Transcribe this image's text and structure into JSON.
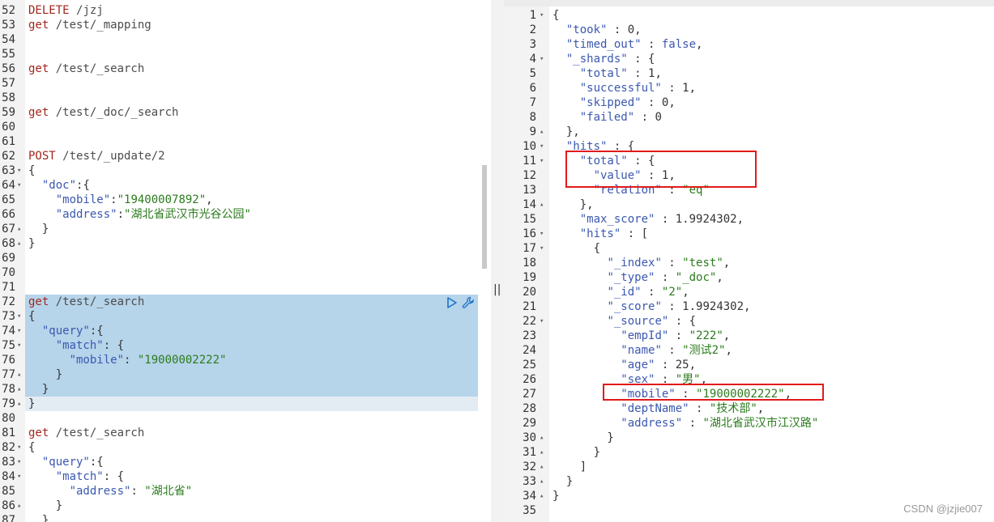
{
  "request_editor": {
    "lines": [
      {
        "n": "52",
        "fold": "",
        "html": [
          [
            "kw-method",
            "DELETE "
          ],
          [
            "kw-path",
            "/jzj"
          ]
        ]
      },
      {
        "n": "53",
        "fold": "",
        "html": [
          [
            "kw-method",
            "get "
          ],
          [
            "kw-path",
            "/test/_mapping"
          ]
        ]
      },
      {
        "n": "54",
        "fold": "",
        "html": []
      },
      {
        "n": "55",
        "fold": "",
        "html": []
      },
      {
        "n": "56",
        "fold": "",
        "html": [
          [
            "kw-method",
            "get "
          ],
          [
            "kw-path",
            "/test/_search"
          ]
        ]
      },
      {
        "n": "57",
        "fold": "",
        "html": []
      },
      {
        "n": "58",
        "fold": "",
        "html": []
      },
      {
        "n": "59",
        "fold": "",
        "html": [
          [
            "kw-method",
            "get "
          ],
          [
            "kw-path",
            "/test/_doc/_search"
          ]
        ]
      },
      {
        "n": "60",
        "fold": "",
        "html": []
      },
      {
        "n": "61",
        "fold": "",
        "html": []
      },
      {
        "n": "62",
        "fold": "",
        "html": [
          [
            "kw-method",
            "POST "
          ],
          [
            "kw-path",
            "/test/_update/2"
          ]
        ]
      },
      {
        "n": "63",
        "fold": "▾",
        "html": [
          [
            "punc",
            "{"
          ]
        ]
      },
      {
        "n": "64",
        "fold": "▾",
        "html": [
          [
            "punc",
            "  "
          ],
          [
            "k",
            "\"doc\""
          ],
          [
            "punc",
            ":{"
          ]
        ]
      },
      {
        "n": "65",
        "fold": "",
        "html": [
          [
            "punc",
            "    "
          ],
          [
            "k",
            "\"mobile\""
          ],
          [
            "punc",
            ":"
          ],
          [
            "s",
            "\"19400007892\""
          ],
          [
            "punc",
            ","
          ]
        ]
      },
      {
        "n": "66",
        "fold": "",
        "html": [
          [
            "punc",
            "    "
          ],
          [
            "k",
            "\"address\""
          ],
          [
            "punc",
            ":"
          ],
          [
            "s",
            "\"湖北省武汉市光谷公园\""
          ]
        ]
      },
      {
        "n": "67",
        "fold": "▴",
        "html": [
          [
            "punc",
            "  }"
          ]
        ]
      },
      {
        "n": "68",
        "fold": "▴",
        "html": [
          [
            "punc",
            "}"
          ]
        ]
      },
      {
        "n": "69",
        "fold": "",
        "html": []
      },
      {
        "n": "70",
        "fold": "",
        "html": []
      },
      {
        "n": "71",
        "fold": "",
        "html": []
      },
      {
        "n": "72",
        "fold": "",
        "html": [
          [
            "kw-method",
            "get "
          ],
          [
            "kw-path",
            "/test/_search"
          ]
        ]
      },
      {
        "n": "73",
        "fold": "▾",
        "html": [
          [
            "punc",
            "{"
          ]
        ]
      },
      {
        "n": "74",
        "fold": "▾",
        "html": [
          [
            "punc",
            "  "
          ],
          [
            "k",
            "\"query\""
          ],
          [
            "punc",
            ":{"
          ]
        ]
      },
      {
        "n": "75",
        "fold": "▾",
        "html": [
          [
            "punc",
            "    "
          ],
          [
            "k",
            "\"match\""
          ],
          [
            "punc",
            ": {"
          ]
        ]
      },
      {
        "n": "76",
        "fold": "",
        "html": [
          [
            "punc",
            "      "
          ],
          [
            "k",
            "\"mobile\""
          ],
          [
            "punc",
            ": "
          ],
          [
            "s",
            "\"19000002222\""
          ]
        ]
      },
      {
        "n": "77",
        "fold": "▴",
        "html": [
          [
            "punc",
            "    }"
          ]
        ]
      },
      {
        "n": "78",
        "fold": "▴",
        "html": [
          [
            "punc",
            "  }"
          ]
        ]
      },
      {
        "n": "79",
        "fold": "▴",
        "html": [
          [
            "punc",
            "}"
          ]
        ]
      },
      {
        "n": "80",
        "fold": "",
        "html": []
      },
      {
        "n": "81",
        "fold": "",
        "html": [
          [
            "kw-method",
            "get "
          ],
          [
            "kw-path",
            "/test/_search"
          ]
        ]
      },
      {
        "n": "82",
        "fold": "▾",
        "html": [
          [
            "punc",
            "{"
          ]
        ]
      },
      {
        "n": "83",
        "fold": "▾",
        "html": [
          [
            "punc",
            "  "
          ],
          [
            "k",
            "\"query\""
          ],
          [
            "punc",
            ":{"
          ]
        ]
      },
      {
        "n": "84",
        "fold": "▾",
        "html": [
          [
            "punc",
            "    "
          ],
          [
            "k",
            "\"match\""
          ],
          [
            "punc",
            ": {"
          ]
        ]
      },
      {
        "n": "85",
        "fold": "",
        "html": [
          [
            "punc",
            "      "
          ],
          [
            "k",
            "\"address\""
          ],
          [
            "punc",
            ": "
          ],
          [
            "s",
            "\"湖北省\""
          ]
        ]
      },
      {
        "n": "86",
        "fold": "▴",
        "html": [
          [
            "punc",
            "    }"
          ]
        ]
      },
      {
        "n": "87",
        "fold": "",
        "html": [
          [
            "punc",
            "  }"
          ]
        ]
      }
    ]
  },
  "response_viewer": {
    "lines": [
      {
        "n": "1",
        "fold": "▾",
        "html": [
          [
            "punc",
            "{"
          ]
        ]
      },
      {
        "n": "2",
        "fold": "",
        "html": [
          [
            "punc",
            "  "
          ],
          [
            "k",
            "\"took\""
          ],
          [
            "punc",
            " : "
          ],
          [
            "num",
            "0"
          ],
          [
            "punc",
            ","
          ]
        ]
      },
      {
        "n": "3",
        "fold": "",
        "html": [
          [
            "punc",
            "  "
          ],
          [
            "k",
            "\"timed_out\""
          ],
          [
            "punc",
            " : "
          ],
          [
            "bool",
            "false"
          ],
          [
            "punc",
            ","
          ]
        ]
      },
      {
        "n": "4",
        "fold": "▾",
        "html": [
          [
            "punc",
            "  "
          ],
          [
            "k",
            "\"_shards\""
          ],
          [
            "punc",
            " : {"
          ]
        ]
      },
      {
        "n": "5",
        "fold": "",
        "html": [
          [
            "punc",
            "    "
          ],
          [
            "k",
            "\"total\""
          ],
          [
            "punc",
            " : "
          ],
          [
            "num",
            "1"
          ],
          [
            "punc",
            ","
          ]
        ]
      },
      {
        "n": "6",
        "fold": "",
        "html": [
          [
            "punc",
            "    "
          ],
          [
            "k",
            "\"successful\""
          ],
          [
            "punc",
            " : "
          ],
          [
            "num",
            "1"
          ],
          [
            "punc",
            ","
          ]
        ]
      },
      {
        "n": "7",
        "fold": "",
        "html": [
          [
            "punc",
            "    "
          ],
          [
            "k",
            "\"skipped\""
          ],
          [
            "punc",
            " : "
          ],
          [
            "num",
            "0"
          ],
          [
            "punc",
            ","
          ]
        ]
      },
      {
        "n": "8",
        "fold": "",
        "html": [
          [
            "punc",
            "    "
          ],
          [
            "k",
            "\"failed\""
          ],
          [
            "punc",
            " : "
          ],
          [
            "num",
            "0"
          ]
        ]
      },
      {
        "n": "9",
        "fold": "▴",
        "html": [
          [
            "punc",
            "  },"
          ]
        ]
      },
      {
        "n": "10",
        "fold": "▾",
        "html": [
          [
            "punc",
            "  "
          ],
          [
            "k",
            "\"hits\""
          ],
          [
            "punc",
            " : {"
          ]
        ]
      },
      {
        "n": "11",
        "fold": "▾",
        "html": [
          [
            "punc",
            "    "
          ],
          [
            "k",
            "\"total\""
          ],
          [
            "punc",
            " : {"
          ]
        ]
      },
      {
        "n": "12",
        "fold": "",
        "html": [
          [
            "punc",
            "      "
          ],
          [
            "k",
            "\"value\""
          ],
          [
            "punc",
            " : "
          ],
          [
            "num",
            "1"
          ],
          [
            "punc",
            ","
          ]
        ]
      },
      {
        "n": "13",
        "fold": "",
        "html": [
          [
            "punc",
            "      "
          ],
          [
            "k",
            "\"relation\""
          ],
          [
            "punc",
            " : "
          ],
          [
            "s",
            "\"eq\""
          ]
        ]
      },
      {
        "n": "14",
        "fold": "▴",
        "html": [
          [
            "punc",
            "    },"
          ]
        ]
      },
      {
        "n": "15",
        "fold": "",
        "html": [
          [
            "punc",
            "    "
          ],
          [
            "k",
            "\"max_score\""
          ],
          [
            "punc",
            " : "
          ],
          [
            "num",
            "1.9924302"
          ],
          [
            "punc",
            ","
          ]
        ]
      },
      {
        "n": "16",
        "fold": "▾",
        "html": [
          [
            "punc",
            "    "
          ],
          [
            "k",
            "\"hits\""
          ],
          [
            "punc",
            " : ["
          ]
        ]
      },
      {
        "n": "17",
        "fold": "▾",
        "html": [
          [
            "punc",
            "      {"
          ]
        ]
      },
      {
        "n": "18",
        "fold": "",
        "html": [
          [
            "punc",
            "        "
          ],
          [
            "k",
            "\"_index\""
          ],
          [
            "punc",
            " : "
          ],
          [
            "s",
            "\"test\""
          ],
          [
            "punc",
            ","
          ]
        ]
      },
      {
        "n": "19",
        "fold": "",
        "html": [
          [
            "punc",
            "        "
          ],
          [
            "k",
            "\"_type\""
          ],
          [
            "punc",
            " : "
          ],
          [
            "s",
            "\"_doc\""
          ],
          [
            "punc",
            ","
          ]
        ]
      },
      {
        "n": "20",
        "fold": "",
        "html": [
          [
            "punc",
            "        "
          ],
          [
            "k",
            "\"_id\""
          ],
          [
            "punc",
            " : "
          ],
          [
            "s",
            "\"2\""
          ],
          [
            "punc",
            ","
          ]
        ]
      },
      {
        "n": "21",
        "fold": "",
        "html": [
          [
            "punc",
            "        "
          ],
          [
            "k",
            "\"_score\""
          ],
          [
            "punc",
            " : "
          ],
          [
            "num",
            "1.9924302"
          ],
          [
            "punc",
            ","
          ]
        ]
      },
      {
        "n": "22",
        "fold": "▾",
        "html": [
          [
            "punc",
            "        "
          ],
          [
            "k",
            "\"_source\""
          ],
          [
            "punc",
            " : {"
          ]
        ]
      },
      {
        "n": "23",
        "fold": "",
        "html": [
          [
            "punc",
            "          "
          ],
          [
            "k",
            "\"empId\""
          ],
          [
            "punc",
            " : "
          ],
          [
            "s",
            "\"222\""
          ],
          [
            "punc",
            ","
          ]
        ]
      },
      {
        "n": "24",
        "fold": "",
        "html": [
          [
            "punc",
            "          "
          ],
          [
            "k",
            "\"name\""
          ],
          [
            "punc",
            " : "
          ],
          [
            "s",
            "\"测试2\""
          ],
          [
            "punc",
            ","
          ]
        ]
      },
      {
        "n": "25",
        "fold": "",
        "html": [
          [
            "punc",
            "          "
          ],
          [
            "k",
            "\"age\""
          ],
          [
            "punc",
            " : "
          ],
          [
            "num",
            "25"
          ],
          [
            "punc",
            ","
          ]
        ]
      },
      {
        "n": "26",
        "fold": "",
        "html": [
          [
            "punc",
            "          "
          ],
          [
            "k",
            "\"sex\""
          ],
          [
            "punc",
            " : "
          ],
          [
            "s",
            "\"男\""
          ],
          [
            "punc",
            ","
          ]
        ]
      },
      {
        "n": "27",
        "fold": "",
        "html": [
          [
            "punc",
            "          "
          ],
          [
            "k",
            "\"mobile\""
          ],
          [
            "punc",
            " : "
          ],
          [
            "s",
            "\"19000002222\""
          ],
          [
            "punc",
            ","
          ]
        ]
      },
      {
        "n": "28",
        "fold": "",
        "html": [
          [
            "punc",
            "          "
          ],
          [
            "k",
            "\"deptName\""
          ],
          [
            "punc",
            " : "
          ],
          [
            "s",
            "\"技术部\""
          ],
          [
            "punc",
            ","
          ]
        ]
      },
      {
        "n": "29",
        "fold": "",
        "html": [
          [
            "punc",
            "          "
          ],
          [
            "k",
            "\"address\""
          ],
          [
            "punc",
            " : "
          ],
          [
            "s",
            "\"湖北省武汉市江汉路\""
          ]
        ]
      },
      {
        "n": "30",
        "fold": "▴",
        "html": [
          [
            "punc",
            "        }"
          ]
        ]
      },
      {
        "n": "31",
        "fold": "▴",
        "html": [
          [
            "punc",
            "      }"
          ]
        ]
      },
      {
        "n": "32",
        "fold": "▴",
        "html": [
          [
            "punc",
            "    ]"
          ]
        ]
      },
      {
        "n": "33",
        "fold": "▴",
        "html": [
          [
            "punc",
            "  }"
          ]
        ]
      },
      {
        "n": "34",
        "fold": "▴",
        "html": [
          [
            "punc",
            "}"
          ]
        ]
      },
      {
        "n": "35",
        "fold": "",
        "html": []
      }
    ]
  },
  "actions": {
    "run_icon": "play-icon",
    "settings_icon": "wrench-icon"
  },
  "split_handle_glyph": "||",
  "watermark": "CSDN @jzjie007",
  "colors": {
    "selection": "#b6d4ea",
    "highlight_box": "#e11b1b",
    "key": "#3b58b0",
    "string": "#2b7b1d",
    "method": "#a1271f"
  }
}
